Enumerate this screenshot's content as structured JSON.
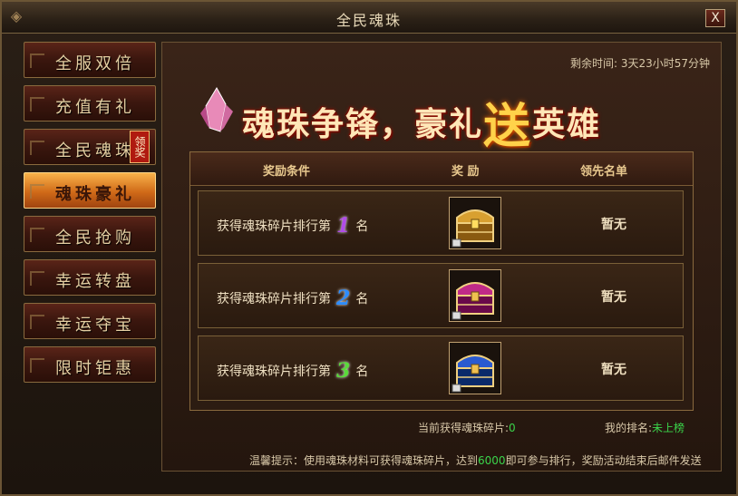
{
  "window": {
    "title": "全民魂珠",
    "close_label": "X"
  },
  "sidebar": {
    "items": [
      {
        "label": "全服双倍",
        "active": false
      },
      {
        "label": "充值有礼",
        "active": false
      },
      {
        "label": "全民魂珠",
        "active": false,
        "badge": "领奖"
      },
      {
        "label": "魂珠豪礼",
        "active": true
      },
      {
        "label": "全民抢购",
        "active": false
      },
      {
        "label": "幸运转盘",
        "active": false
      },
      {
        "label": "幸运夺宝",
        "active": false
      },
      {
        "label": "限时钜惠",
        "active": false
      }
    ]
  },
  "main": {
    "remaining_label": "剩余时间:",
    "remaining_value": "3天23小时57分钟",
    "banner": {
      "part1": "魂珠争锋，豪礼",
      "part2": "送",
      "part3": "英雄"
    },
    "table": {
      "headers": [
        "奖励条件",
        "奖 励",
        "领先名单"
      ],
      "rows": [
        {
          "prefix": "获得魂珠碎片排行第",
          "rank": "1",
          "suffix": "名",
          "chest": "gold-chest",
          "leader": "暂无"
        },
        {
          "prefix": "获得魂珠碎片排行第",
          "rank": "2",
          "suffix": "名",
          "chest": "purple-chest",
          "leader": "暂无"
        },
        {
          "prefix": "获得魂珠碎片排行第",
          "rank": "3",
          "suffix": "名",
          "chest": "blue-chest",
          "leader": "暂无"
        }
      ]
    },
    "progress_label": "当前获得魂珠碎片:",
    "progress_value": "0",
    "my_rank_label": "我的排名:",
    "my_rank_value": "未上榜",
    "tip_prefix": "温馨提示：使用魂珠材料可获得魂珠碎片，达到",
    "tip_threshold": "6000",
    "tip_suffix": "即可参与排行，奖励活动结束后邮件发送"
  }
}
